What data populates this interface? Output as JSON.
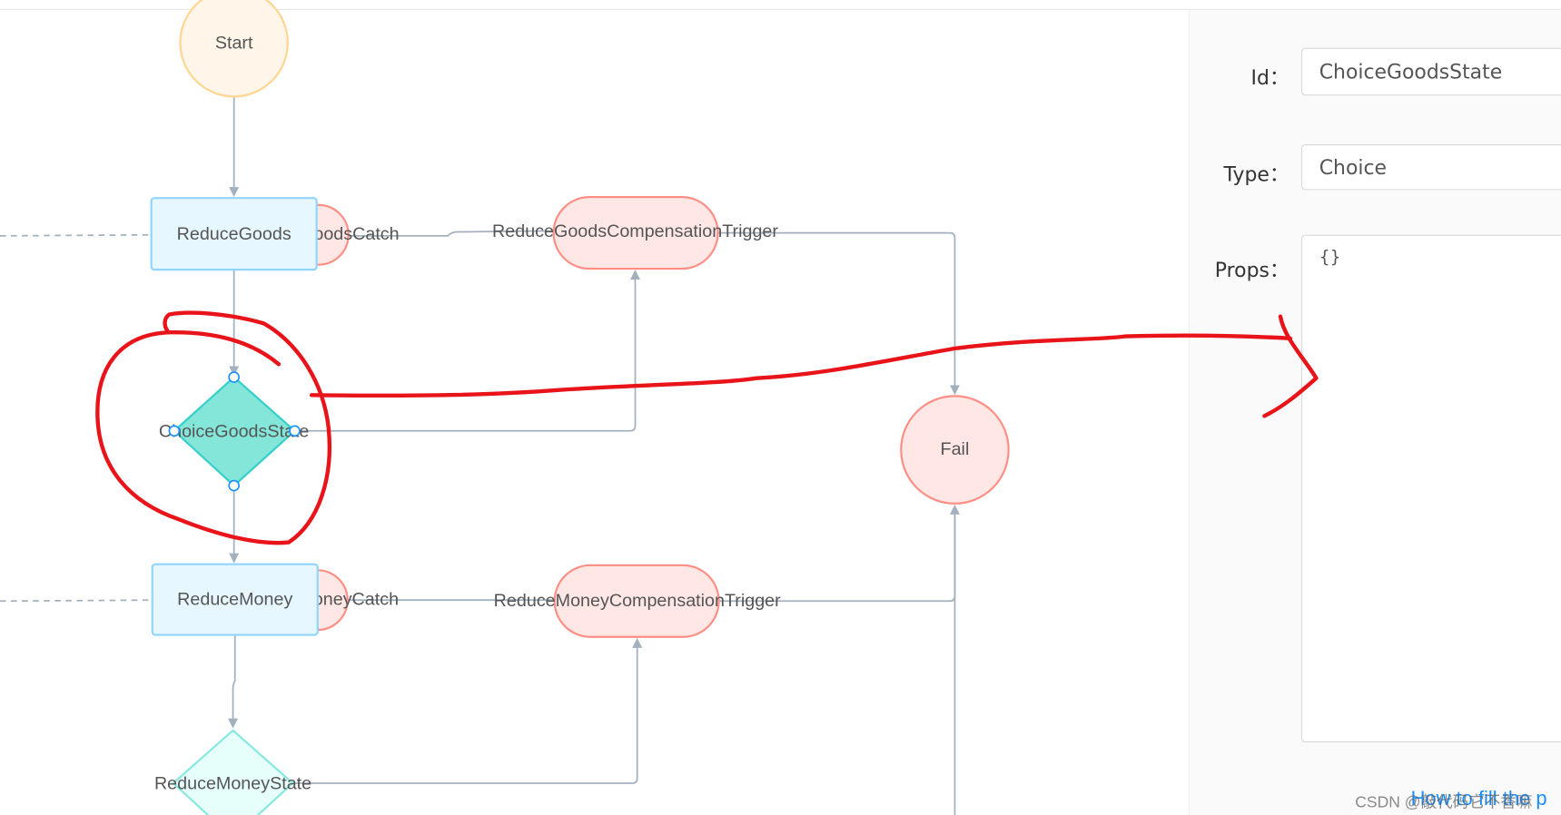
{
  "flow": {
    "start": "Start",
    "reduce_goods": "ReduceGoods",
    "reduce_goods_catch": "ReduceGoodsCatch",
    "reduce_goods_compensation": "ReduceGoodsCompensationTrigger",
    "choice_goods_state": "ChoiceGoodsState",
    "fail": "Fail",
    "reduce_money": "ReduceMoney",
    "reduce_money_catch": "ReduceMoneyCatch",
    "reduce_money_compensation": "ReduceMoneyCompensationTrigger",
    "reduce_money_state": "ReduceMoneyState"
  },
  "panel": {
    "id_label": "Id：",
    "id_value": "ChoiceGoodsState",
    "type_label": "Type：",
    "type_value": "Choice",
    "props_label": "Props：",
    "props_value": "{}",
    "help_link": "How to fill the p"
  },
  "watermark": "CSDN @敲代码它不香嘛",
  "colors": {
    "annotation": "#e8141a",
    "link": "#1890ff",
    "edge": "#a3b1bf"
  }
}
